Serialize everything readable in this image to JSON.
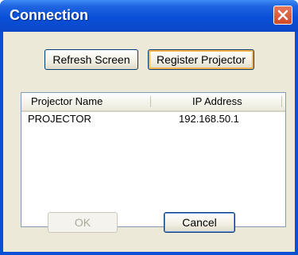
{
  "window": {
    "title": "Connection"
  },
  "toolbar": {
    "refresh_label": "Refresh Screen",
    "register_label": "Register Projector"
  },
  "list": {
    "columns": [
      "Projector Name",
      "IP Address"
    ],
    "rows": [
      {
        "name": "PROJECTOR",
        "ip": "192.168.50.1"
      }
    ]
  },
  "footer": {
    "ok_label": "OK",
    "cancel_label": "Cancel"
  },
  "colors": {
    "titlebar": "#0a50d8",
    "close": "#d04a26",
    "dialog_bg": "#ece9d8"
  }
}
